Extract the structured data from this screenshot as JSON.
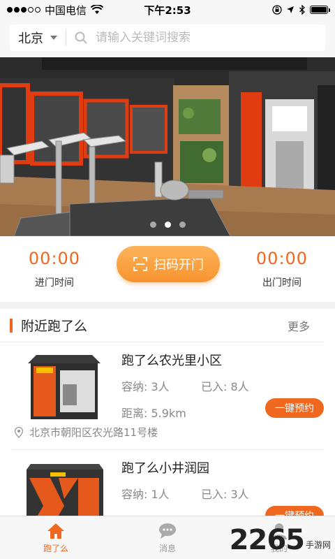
{
  "status_bar": {
    "carrier": "中国电信",
    "time": "下午2:53",
    "battery_level": 1.0
  },
  "search": {
    "city": "北京",
    "placeholder": "请输入关键词搜索"
  },
  "banner": {
    "dot_count": 3,
    "active_dot": 1
  },
  "door": {
    "enter_time": "00:00",
    "enter_label": "进门时间",
    "scan_label": "扫码开门",
    "exit_time": "00:00",
    "exit_label": "出门时间"
  },
  "nearby": {
    "title": "附近跑了么",
    "more": "更多",
    "items": [
      {
        "name": "跑了么农光里小区",
        "capacity": "容纳: 3人",
        "entered": "已入: 8人",
        "distance": "距离: 5.9km",
        "book": "一键预约",
        "address": "北京市朝阳区农光路11号楼"
      },
      {
        "name": "跑了么小井润园",
        "capacity": "容纳: 1人",
        "entered": "已入: 3人",
        "book": "一键预约"
      }
    ]
  },
  "nav": {
    "items": [
      {
        "label": "跑了么",
        "icon": "home-icon",
        "active": true
      },
      {
        "label": "消息",
        "icon": "message-icon",
        "active": false
      },
      {
        "label": "我的",
        "icon": "user-icon",
        "active": false
      }
    ]
  },
  "watermark": {
    "number": "2265",
    "text": "手游网"
  },
  "colors": {
    "accent": "#f0671f",
    "scan_button": "#f7942f"
  }
}
